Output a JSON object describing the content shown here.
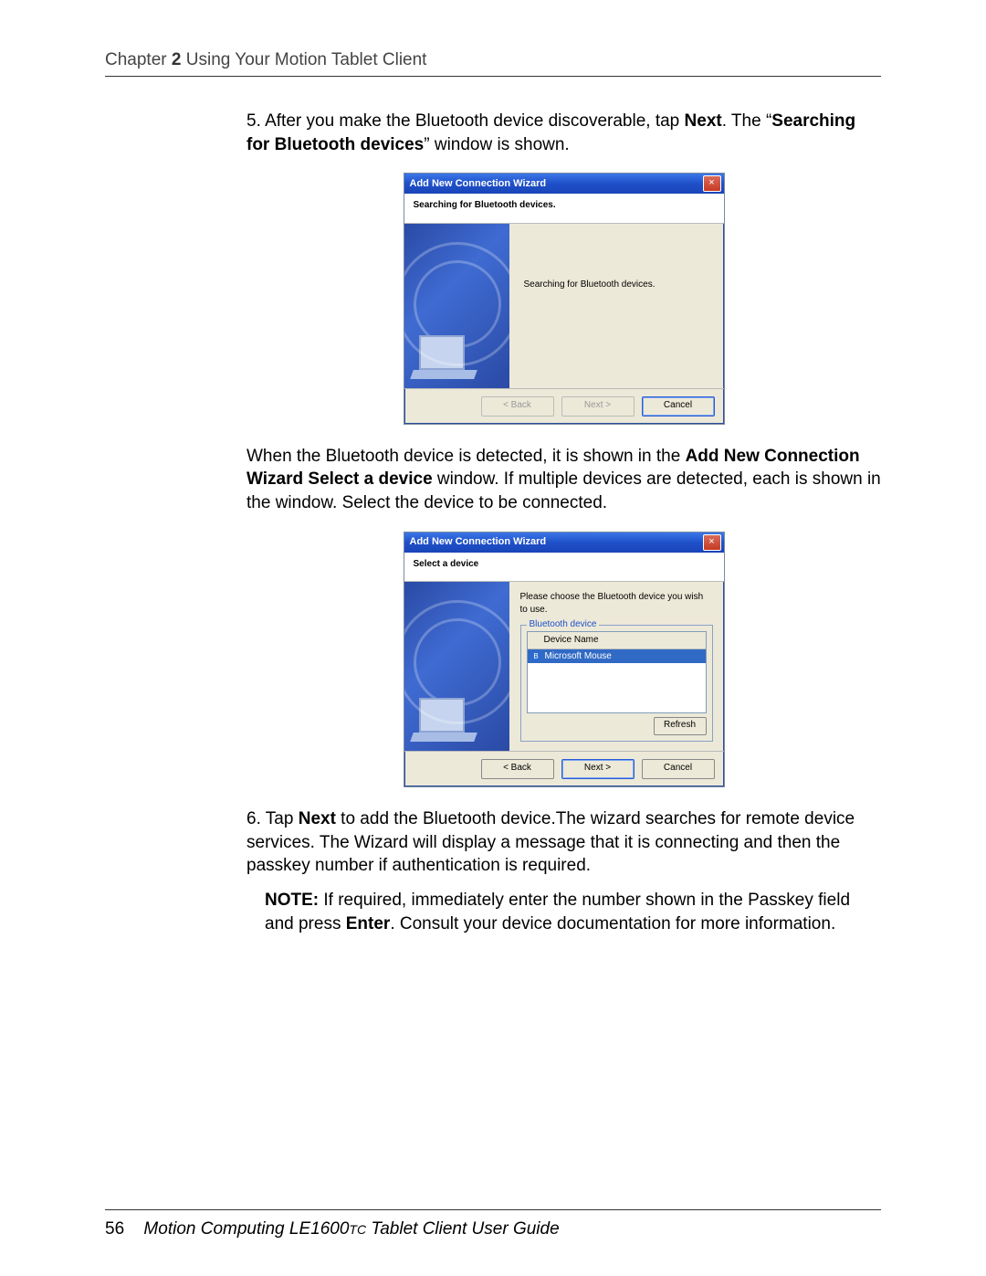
{
  "chapter": {
    "label_chapter": "Chapter",
    "number": "2",
    "title": "Using Your Motion Tablet Client"
  },
  "step5": {
    "num": "5.",
    "text_a": "After you make the Bluetooth device discoverable, tap ",
    "bold_next": "Next",
    "text_b": ". The “",
    "bold_search": "Searching for Bluetooth devices",
    "text_c": "” window is shown."
  },
  "wiz1": {
    "title": "Add New Connection Wizard",
    "close": "×",
    "header": "Searching for Bluetooth devices.",
    "body_msg": "Searching for Bluetooth devices.",
    "btn_back": "< Back",
    "btn_next": "Next >",
    "btn_cancel": "Cancel"
  },
  "mid_para": {
    "a": "When the Bluetooth device is detected, it is shown in the ",
    "b1": "Add New Connection Wizard Select a device",
    "c": " window. If multiple devices are detected, each is shown in the window. Select the device to be connected."
  },
  "wiz2": {
    "title": "Add New Connection Wizard",
    "close": "×",
    "header": "Select a device",
    "instr": "Please choose the Bluetooth device you wish to use.",
    "group_legend": "Bluetooth device",
    "col_head": "Device Name",
    "row1": "Microsoft Mouse",
    "btn_refresh": "Refresh",
    "btn_back": "< Back",
    "btn_next": "Next >",
    "btn_cancel": "Cancel"
  },
  "step6": {
    "num": "6.",
    "a": "Tap ",
    "bold_next": "Next",
    "b": " to add the Bluetooth device.The wizard searches for remote device services. The Wizard will display a message that it is connecting and then the passkey number if authentication is required."
  },
  "note": {
    "label": "NOTE:",
    "a": " If required, immediately enter the number shown in the Passkey field and press ",
    "bold_enter": "Enter",
    "b": ". Consult your device documentation for more information."
  },
  "footer": {
    "page": "56",
    "a": "Motion Computing LE1600",
    "tc": "TC",
    "b": " Tablet Client User Guide"
  }
}
